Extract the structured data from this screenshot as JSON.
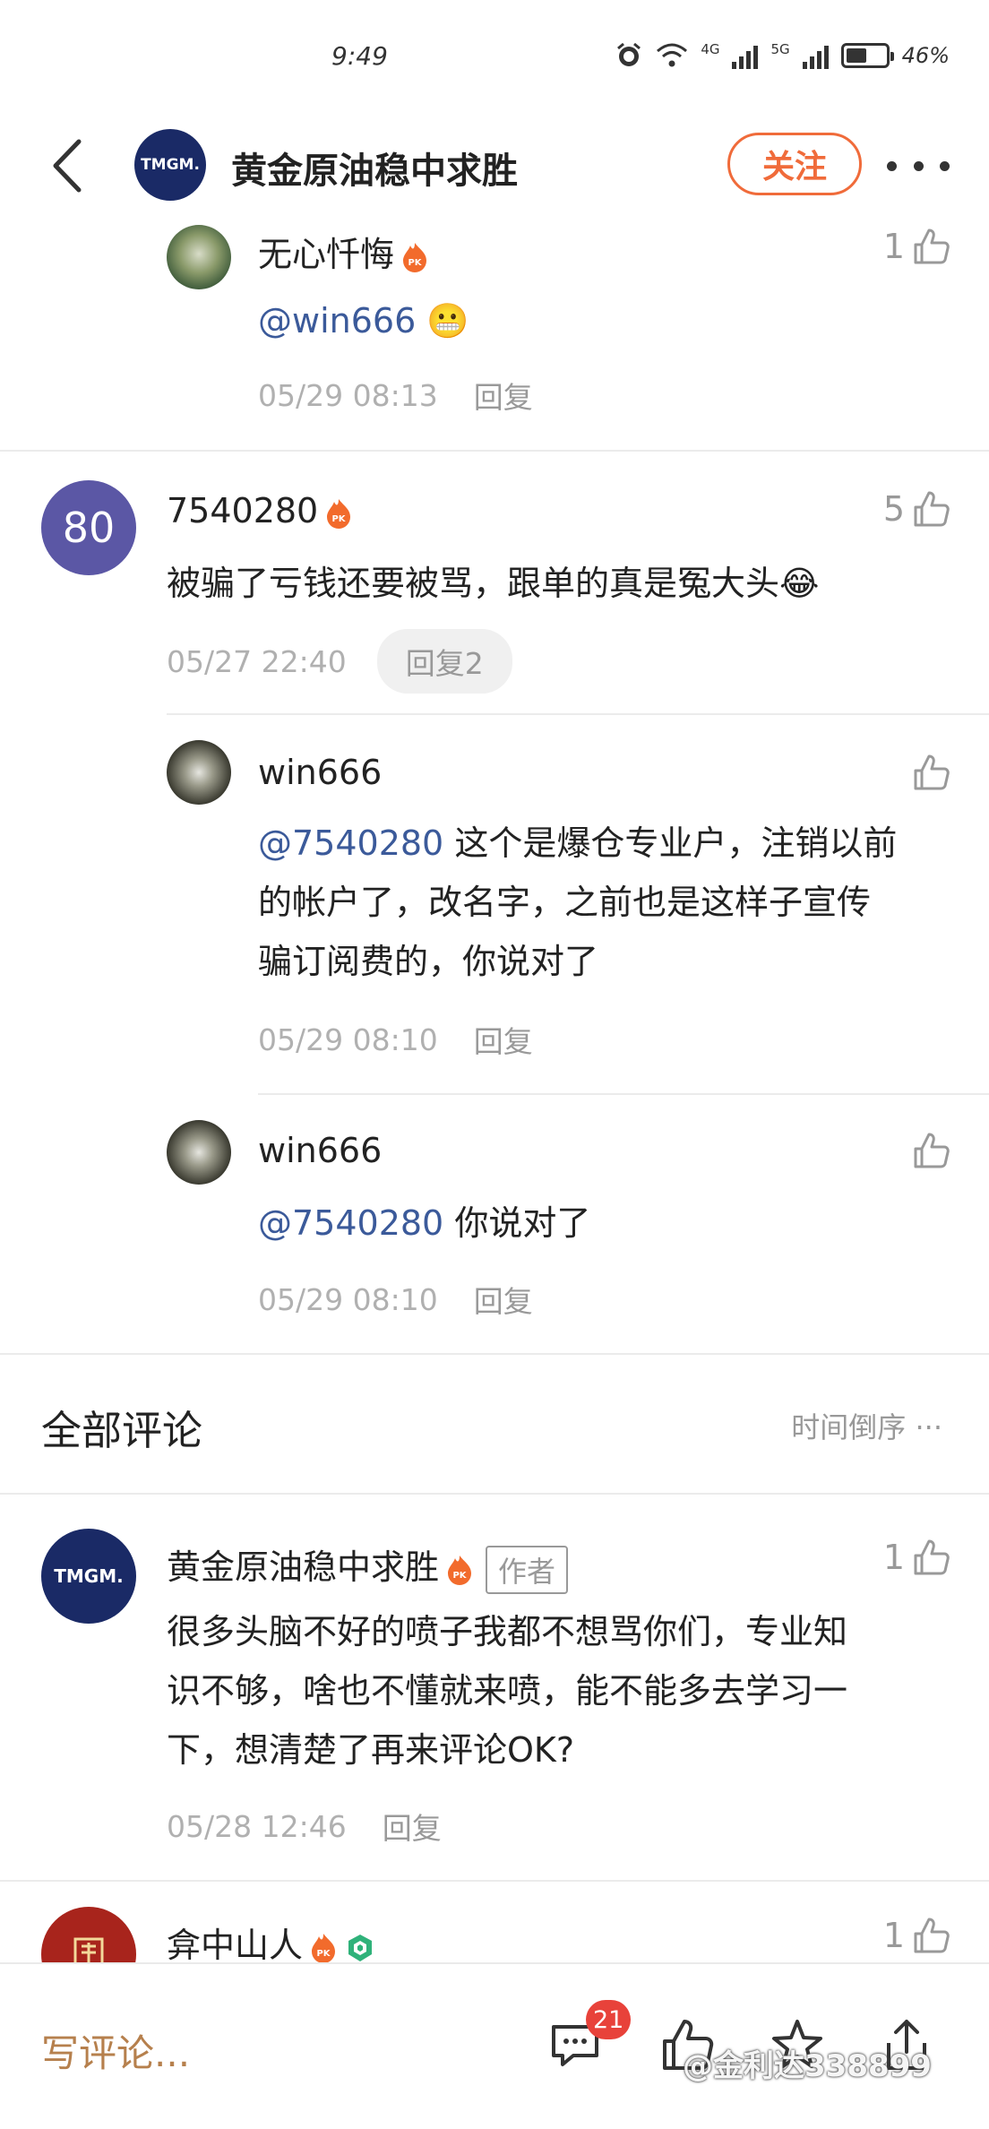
{
  "status": {
    "time": "9:49",
    "net1": "4G",
    "net2": "5G",
    "battery": "46%"
  },
  "header": {
    "logo_text": "TMGM.",
    "title": "黄金原油稳中求胜",
    "follow_label": "关注"
  },
  "replies": [
    {
      "name": "无心忏悔",
      "mention": "@win666",
      "text": "😬",
      "time": "05/29 08:13",
      "reply_label": "回复",
      "likes": "1"
    }
  ],
  "thread": {
    "avatar_text": "80",
    "name": "7540280",
    "text": "被骗了亏钱还要被骂，跟单的真是冤大头😂",
    "time": "05/27 22:40",
    "reply_label": "回复2",
    "likes": "5",
    "subreplies": [
      {
        "name": "win666",
        "mention": "@7540280",
        "text_line1": " 这个是爆仓专业户，注销以前",
        "text_line2": "的帐户了，改名字，之前也是这样子宣传",
        "text_line3": "骗订阅费的，你说对了",
        "time": "05/29 08:10",
        "reply_label": "回复"
      },
      {
        "name": "win666",
        "mention": "@7540280",
        "text": " 你说对了",
        "time": "05/29 08:10",
        "reply_label": "回复"
      }
    ]
  },
  "section": {
    "title": "全部评论",
    "sort_label": "时间倒序 ···"
  },
  "author_comment": {
    "name": "黄金原油稳中求胜",
    "tag": "作者",
    "likes": "1",
    "line1": "很多头脑不好的喷子我都不想骂你们，专业知",
    "line2": "识不够，啥也不懂就来喷，能不能多去学习一",
    "line3": "下，想清楚了再来评论OK?",
    "time": "05/28 12:46",
    "reply_label": "回复"
  },
  "next_comment": {
    "name": "弇中山人",
    "likes": "1"
  },
  "bottom": {
    "write_label": "写评论...",
    "comment_count": "21",
    "watermark": "@金利达338899"
  },
  "colors": {
    "accent": "#f06b3a",
    "mention": "#3b5a9a",
    "badge": "#e8423a",
    "write": "#b6804d"
  }
}
